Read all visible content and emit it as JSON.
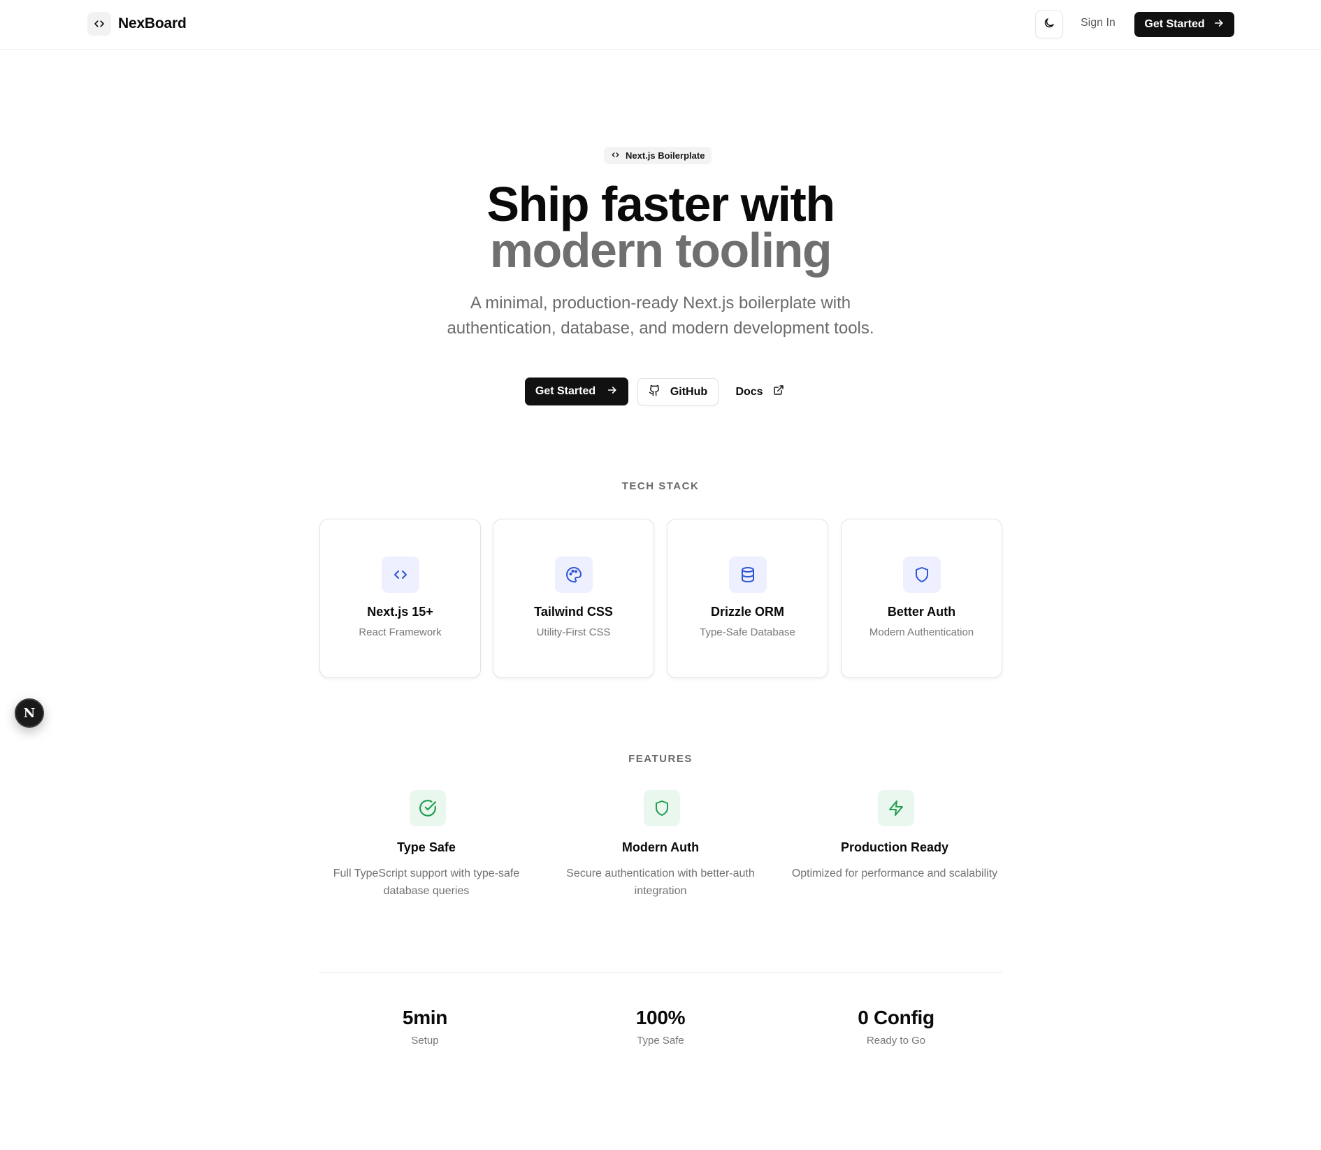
{
  "header": {
    "brand_name": "NexBoard",
    "sign_in": "Sign In",
    "cta": "Get Started"
  },
  "hero": {
    "badge": "Next.js Boilerplate",
    "title_line1": "Ship faster with",
    "title_line2": "modern tooling",
    "subtitle_line1": "A minimal, production-ready Next.js boilerplate with",
    "subtitle_line2": "authentication, database, and modern development tools.",
    "primary_button": "Get Started",
    "github_button": "GitHub",
    "docs_button": "Docs"
  },
  "tech_stack": {
    "label": "TECH STACK",
    "items": [
      {
        "title": "Next.js 15+",
        "subtitle": "React Framework",
        "icon": "code-icon"
      },
      {
        "title": "Tailwind CSS",
        "subtitle": "Utility-First CSS",
        "icon": "palette-icon"
      },
      {
        "title": "Drizzle ORM",
        "subtitle": "Type-Safe Database",
        "icon": "database-icon"
      },
      {
        "title": "Better Auth",
        "subtitle": "Modern Authentication",
        "icon": "shield-icon"
      }
    ]
  },
  "features": {
    "label": "FEATURES",
    "items": [
      {
        "title": "Type Safe",
        "description": "Full TypeScript support with type-safe database queries",
        "icon": "check-circle-icon"
      },
      {
        "title": "Modern Auth",
        "description": "Secure authentication with better-auth integration",
        "icon": "shield-icon"
      },
      {
        "title": "Production Ready",
        "description": "Optimized for performance and scalability",
        "icon": "zap-icon"
      }
    ]
  },
  "stats": [
    {
      "value": "5min",
      "label": "Setup"
    },
    {
      "value": "100%",
      "label": "Type Safe"
    },
    {
      "value": "0 Config",
      "label": "Ready to Go"
    }
  ],
  "fab": {
    "letter": "N"
  },
  "colors": {
    "primary": "#111111",
    "tech_icon_bg": "#eef0ff",
    "tech_icon": "#2f55d4",
    "feature_icon_bg": "#e9f7ee",
    "feature_icon": "#1f9d50",
    "muted_text": "#6f6f6f"
  }
}
